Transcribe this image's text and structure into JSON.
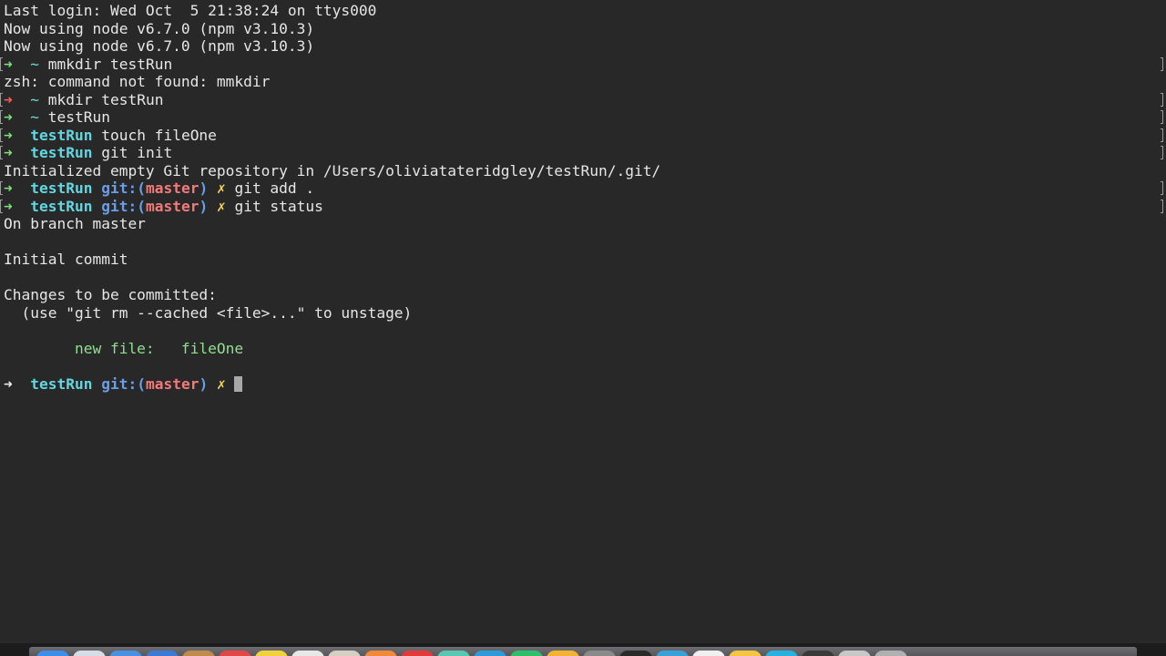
{
  "terminal": {
    "last_login": "Last login: Wed Oct  5 21:38:24 on ttys000",
    "node_line_1": "Now using node v6.7.0 (npm v3.10.3)",
    "node_line_2": "Now using node v6.7.0 (npm v3.10.3)",
    "prompt_arrow": "➜",
    "tilde": "~",
    "cmd_mmkdir": "mmkdir testRun",
    "err_not_found": "zsh: command not found: mmkdir",
    "cmd_mkdir": "mkdir testRun",
    "cmd_testrun": "testRun",
    "dir_name": "testRun",
    "cmd_touch": "touch fileOne",
    "cmd_git_init": "git init",
    "init_output": "Initialized empty Git repository in /Users/oliviatateridgley/testRun/.git/",
    "git_prefix": "git:(",
    "branch_name": "master",
    "git_suffix": ")",
    "dirty_mark": "✗",
    "cmd_git_add": "git add .",
    "cmd_git_status": "git status",
    "on_branch": "On branch master",
    "initial_commit": "Initial commit",
    "changes_header": "Changes to be committed:",
    "unstage_hint": "  (use \"git rm --cached <file>...\" to unstage)",
    "new_file_label": "        new file:   ",
    "new_file_name": "fileOne"
  },
  "colors": {
    "background": "#282828",
    "foreground": "#e6e6e6",
    "prompt_success": "#7fe07f",
    "prompt_error": "#ff5f5f",
    "directory": "#62d6e0",
    "git_label": "#6a9ee8",
    "branch": "#f47a7a",
    "dirty_mark": "#f0d060",
    "staged_file": "#8ee08e"
  },
  "dock": {
    "icons": [
      "finder-icon",
      "safari-icon",
      "chrome-icon",
      "mail-icon",
      "contacts-icon",
      "calendar-icon",
      "notes-icon",
      "reminders-icon",
      "maps-icon",
      "photos-icon",
      "messages-icon",
      "facetime-icon",
      "itunes-icon",
      "ibooks-icon",
      "app-store-icon",
      "system-preferences-icon",
      "terminal-icon",
      "slack-icon",
      "sketch-icon",
      "atom-icon",
      "spotify-icon",
      "evernote-icon",
      "downloads-icon",
      "trash-icon"
    ]
  }
}
